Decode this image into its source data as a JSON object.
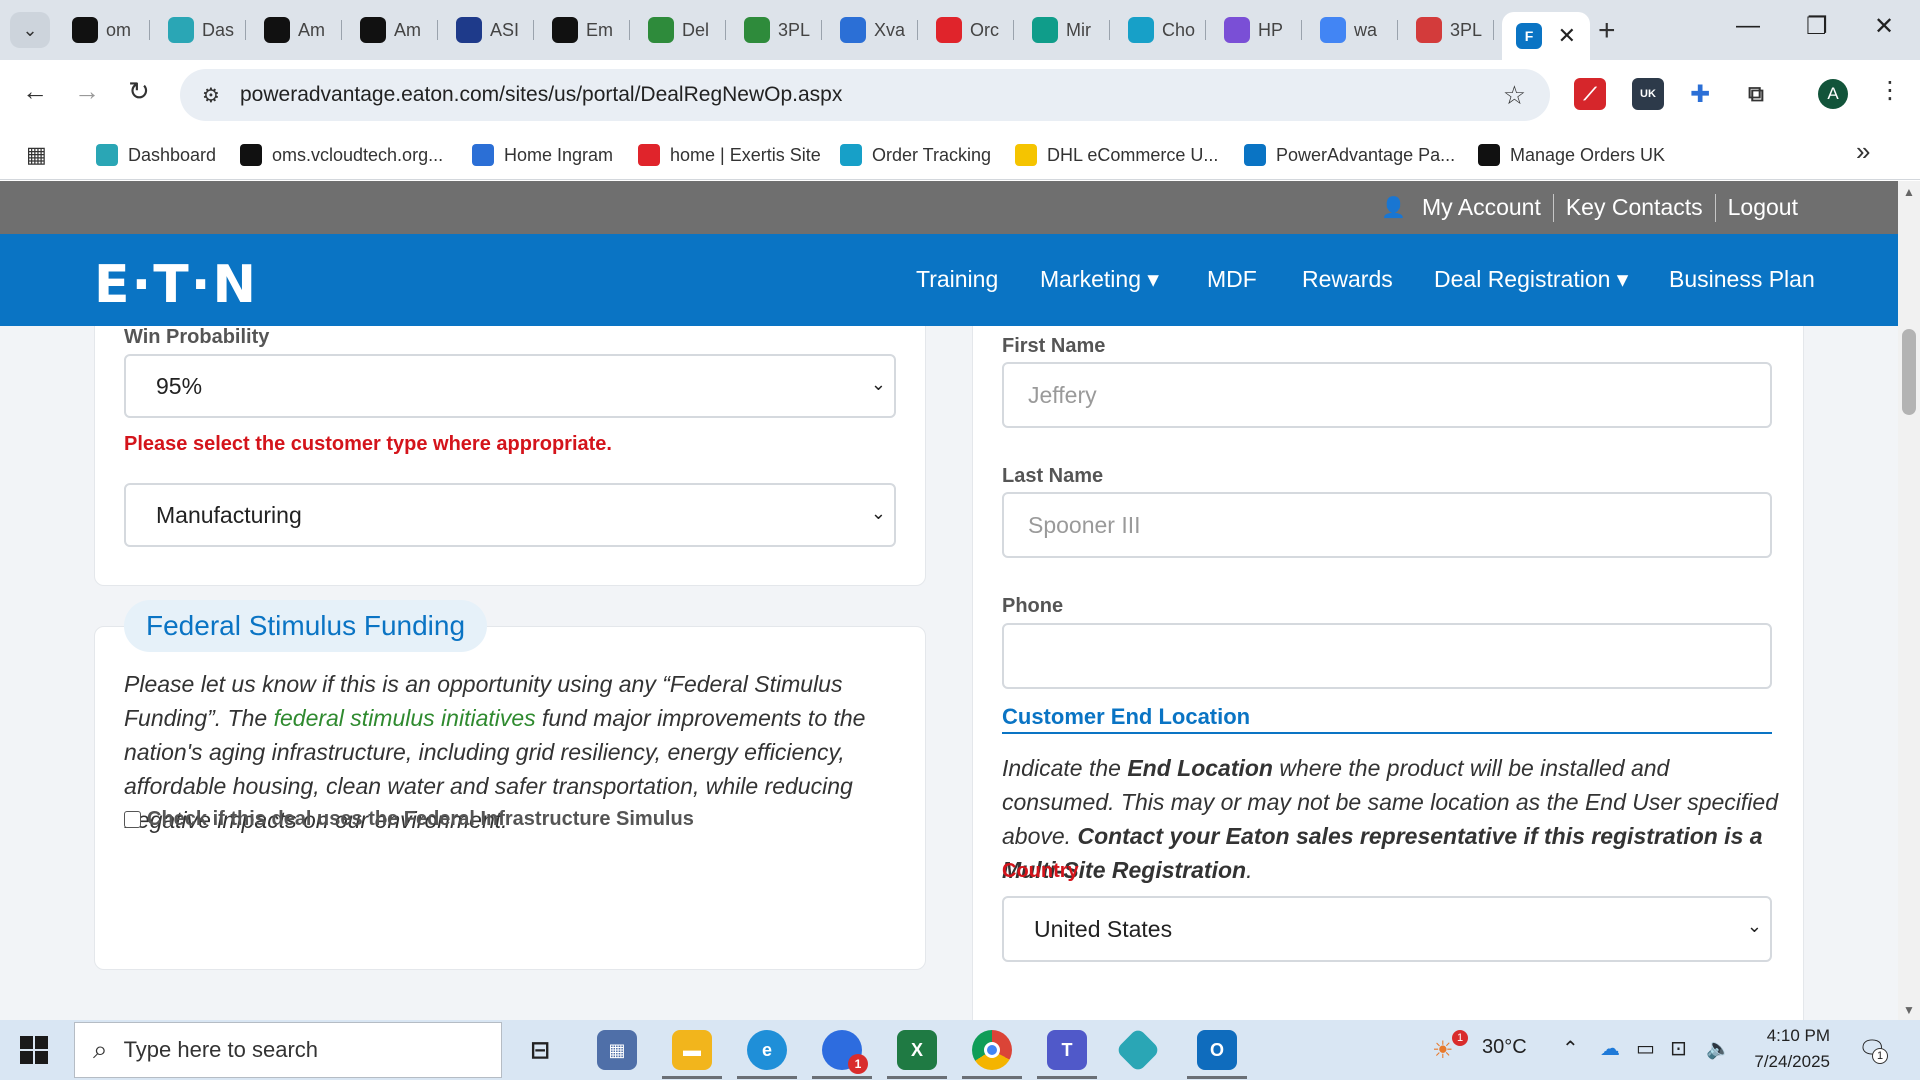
{
  "browser": {
    "tabs": [
      {
        "label": "om",
        "icon": "triangle-logo-icon",
        "color": "#111111"
      },
      {
        "label": "Das",
        "icon": "hexagon-logo-icon",
        "color": "#2aa6b5"
      },
      {
        "label": "Am",
        "icon": "amazon-icon",
        "color": "#111111"
      },
      {
        "label": "Am",
        "icon": "amazon-icon",
        "color": "#111111"
      },
      {
        "label": "ASI",
        "icon": "arrow-logo-icon",
        "color": "#1e3a8a"
      },
      {
        "label": "Em",
        "icon": "openai-icon",
        "color": "#111111"
      },
      {
        "label": "Del",
        "icon": "stack-logo-icon",
        "color": "#2e8b3b"
      },
      {
        "label": "3PL",
        "icon": "stack-logo-icon",
        "color": "#2e8b3b"
      },
      {
        "label": "Xva",
        "icon": "swirl-logo-icon",
        "color": "#2b6fd6"
      },
      {
        "label": "Orc",
        "icon": "exertis-icon",
        "color": "#e0242b"
      },
      {
        "label": "Mir",
        "icon": "circle-logo-icon",
        "color": "#0f9d8a"
      },
      {
        "label": "Cho",
        "icon": "swirl-c-icon",
        "color": "#17a0c8"
      },
      {
        "label": "HP",
        "icon": "hp-icon",
        "color": "#7a4fd6"
      },
      {
        "label": "wa",
        "icon": "google-icon",
        "color": "#4285f4"
      },
      {
        "label": "3PL",
        "icon": "shoe-logo-icon",
        "color": "#d33b3b"
      }
    ],
    "active_tab_close": "✕",
    "new_tab": "+",
    "window_controls": {
      "minimize": "—",
      "restore": "❐",
      "close": "✕"
    },
    "url": "poweradvantage.eaton.com/sites/us/portal/DealRegNewOp.aspx",
    "profile_initial": "A",
    "extension_badge": "UK",
    "bookmarks": [
      {
        "label": "Dashboard",
        "icon": "hexagon-logo-icon",
        "color": "#2aa6b5"
      },
      {
        "label": "oms.vcloudtech.org...",
        "icon": "triangle-logo-icon",
        "color": "#111111"
      },
      {
        "label": "Home Ingram",
        "icon": "ingram-icon",
        "color": "#2b6fd6"
      },
      {
        "label": "home | Exertis Site",
        "icon": "exertis-icon",
        "color": "#e0242b"
      },
      {
        "label": "Order Tracking",
        "icon": "swirl-c-icon",
        "color": "#17a0c8"
      },
      {
        "label": "DHL eCommerce U...",
        "icon": "dhl-icon",
        "color": "#f5c400"
      },
      {
        "label": "PowerAdvantage Pa...",
        "icon": "powerad-icon",
        "color": "#0a74c4"
      },
      {
        "label": "Manage Orders UK",
        "icon": "amazon-icon",
        "color": "#111111"
      }
    ],
    "bookmarks_overflow": "»"
  },
  "site": {
    "top_links": [
      "My Account",
      "Key Contacts",
      "Logout"
    ],
    "logo": "E·T·N",
    "nav": [
      "Training",
      "Marketing ▾",
      "MDF",
      "Rewards",
      "Deal Registration ▾",
      "Business Plan"
    ]
  },
  "form": {
    "win_probability": {
      "label": "Win Probability",
      "value": "95%"
    },
    "customer_type": {
      "warning": "Please select the customer type where appropriate.",
      "value": "Manufacturing"
    },
    "federal": {
      "heading": "Federal Stimulus Funding",
      "p1": "Please let us know if this is an opportunity using any “Federal Stimulus Funding”. The ",
      "link": "federal stimulus initiatives",
      "p2": " fund major improvements to the nation's aging infrastructure, including grid resiliency, energy efficiency, affordable housing, clean water and safer transportation, while reducing negative impacts on our environment.",
      "checkbox_label": "Check if this deal uses the Federal Infrastructure Simulus"
    },
    "first_name": {
      "label": "First Name",
      "placeholder": "Jeffery"
    },
    "last_name": {
      "label": "Last Name",
      "placeholder": "Spooner III"
    },
    "phone": {
      "label": "Phone",
      "placeholder": ""
    },
    "end_location": {
      "heading": "Customer End Location",
      "t1": "Indicate the ",
      "b1": "End Location",
      "t2": " where the product will be installed and consumed. This may or may not be same location as the End User specified above. ",
      "b2": "Contact your Eaton sales representative if this registration is a Multi-Site Registration",
      "t3": "."
    },
    "country": {
      "label": "Country",
      "value": "United States"
    }
  },
  "taskbar": {
    "search_placeholder": "Type here to search",
    "apps": [
      "task-view-icon",
      "calculator-icon",
      "file-explorer-icon",
      "edge-icon",
      "zoom-icon",
      "excel-icon",
      "chrome-icon",
      "teams-icon",
      "hexagon-app-icon",
      "outlook-icon"
    ],
    "zoom_badge": "1",
    "weather_badge": "1",
    "weather": "30°C",
    "time": "4:10 PM",
    "date": "7/24/2025",
    "notification_count": "1"
  }
}
